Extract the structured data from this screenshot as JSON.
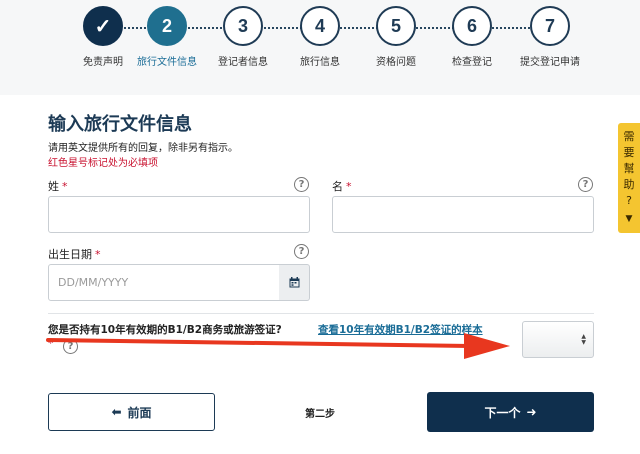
{
  "steps": [
    {
      "number": "✓",
      "label": "免责声明"
    },
    {
      "number": "2",
      "label": "旅行文件信息"
    },
    {
      "number": "3",
      "label": "登记者信息"
    },
    {
      "number": "4",
      "label": "旅行信息"
    },
    {
      "number": "5",
      "label": "资格问题"
    },
    {
      "number": "6",
      "label": "检查登记"
    },
    {
      "number": "7",
      "label": "提交登记申请"
    }
  ],
  "help_tab": {
    "chars": [
      "需",
      "要",
      "幫",
      "助",
      "?"
    ],
    "arrow": "▼"
  },
  "form": {
    "title": "输入旅行文件信息",
    "hint": "请用英文提供所有的回复，除非另有指示。",
    "required_note": "红色星号标记处为必填项",
    "required_mark": "*",
    "help_icon": "?",
    "surname": {
      "label": "姓",
      "value": ""
    },
    "given_name": {
      "label": "名",
      "value": ""
    },
    "dob": {
      "label": "出生日期",
      "placeholder": "DD/MM/YYYY",
      "icon": "calendar-icon"
    },
    "visa_question": {
      "text": "您是否持有10年有效期的B1/B2商务或旅游签证?",
      "link": "查看10年有效期B1/B2签证的样本",
      "selected": ""
    }
  },
  "nav": {
    "back_label": "前面",
    "back_icon": "⬅",
    "step_text": "第二步",
    "next_label": "下一个",
    "next_icon": "➜"
  },
  "colors": {
    "navy": "#0f2f4d",
    "active_teal": "#1f6f8f",
    "required_red": "#c8102e",
    "help_yellow": "#f4c530",
    "annotation_red": "#e8371f"
  }
}
